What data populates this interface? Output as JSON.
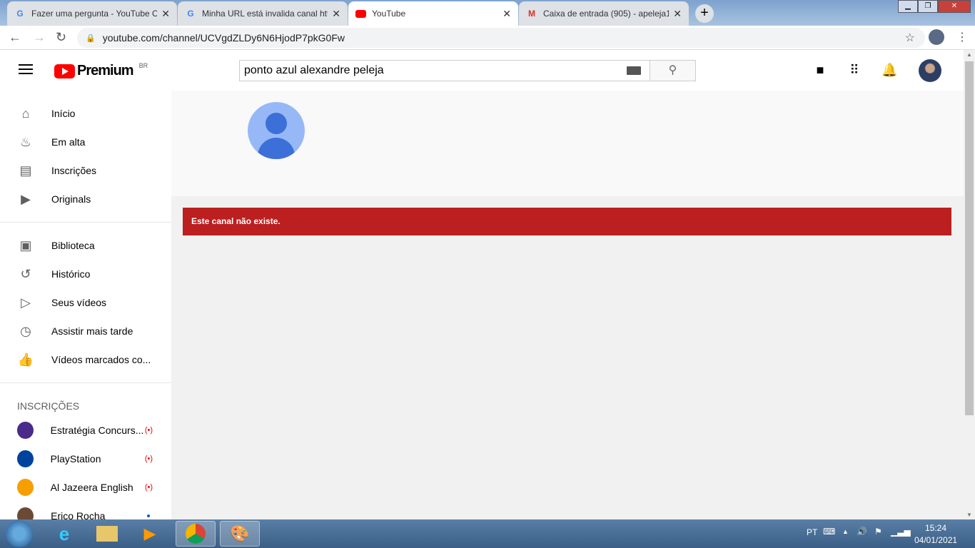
{
  "browser": {
    "tabs": [
      {
        "title": "Fazer uma pergunta - YouTube C",
        "favicon": "google-icon",
        "active": false
      },
      {
        "title": "Minha URL está invalida canal htt",
        "favicon": "google-icon",
        "active": false
      },
      {
        "title": "YouTube",
        "favicon": "youtube-icon",
        "active": true
      },
      {
        "title": "Caixa de entrada (905) - apeleja1",
        "favicon": "gmail-icon",
        "active": false
      }
    ],
    "url": "youtube.com/channel/UCVgdZLDy6N6HjodP7pkG0Fw"
  },
  "header": {
    "logo": "Premium",
    "region": "BR",
    "search_value": "ponto azul alexandre peleja"
  },
  "sidebar": {
    "main": [
      {
        "label": "Início",
        "icon": "home-icon"
      },
      {
        "label": "Em alta",
        "icon": "fire-icon"
      },
      {
        "label": "Inscrições",
        "icon": "subscriptions-icon"
      },
      {
        "label": "Originals",
        "icon": "originals-icon"
      }
    ],
    "library": [
      {
        "label": "Biblioteca",
        "icon": "library-icon"
      },
      {
        "label": "Histórico",
        "icon": "history-icon"
      },
      {
        "label": "Seus vídeos",
        "icon": "your-videos-icon"
      },
      {
        "label": "Assistir mais tarde",
        "icon": "clock-icon"
      },
      {
        "label": "Vídeos marcados co...",
        "icon": "thumbs-up-icon"
      }
    ],
    "subs_heading": "INSCRIÇÕES",
    "subscriptions": [
      {
        "label": "Estratégia Concurs...",
        "status": "live",
        "color": "#4a2a8a"
      },
      {
        "label": "PlayStation",
        "status": "live",
        "color": "#00439c"
      },
      {
        "label": "Al Jazeera English",
        "status": "live",
        "color": "#f5a000"
      },
      {
        "label": "Erico Rocha",
        "status": "new",
        "color": "#6b4a35"
      }
    ]
  },
  "main": {
    "error": "Este canal não existe."
  },
  "taskbar": {
    "lang": "PT",
    "time": "15:24",
    "date": "04/01/2021"
  }
}
